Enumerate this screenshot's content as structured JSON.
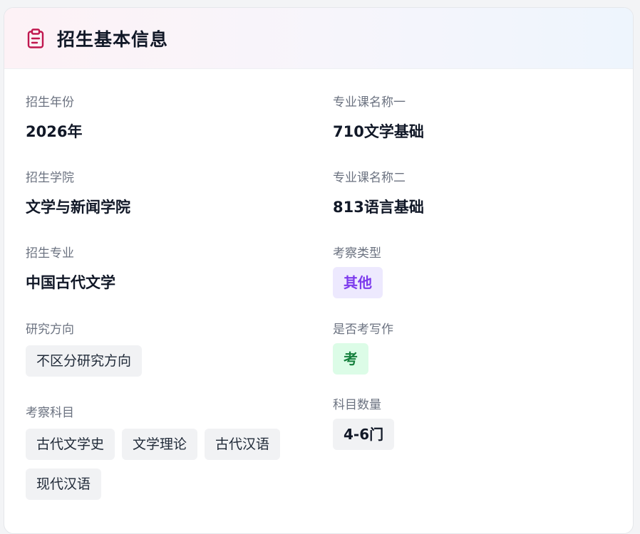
{
  "header": {
    "title": "招生基本信息",
    "icon": "clipboard-icon",
    "icon_color": "#c0174f"
  },
  "left": {
    "year": {
      "label": "招生年份",
      "value": "2026年"
    },
    "college": {
      "label": "招生学院",
      "value": "文学与新闻学院"
    },
    "major": {
      "label": "招生专业",
      "value": "中国古代文学"
    },
    "direction": {
      "label": "研究方向",
      "tag": "不区分研究方向"
    },
    "subjects": {
      "label": "考察科目",
      "tags": [
        "古代文学史",
        "文学理论",
        "古代汉语",
        "现代汉语"
      ]
    }
  },
  "right": {
    "course1": {
      "label": "专业课名称一",
      "value": "710文学基础"
    },
    "course2": {
      "label": "专业课名称二",
      "value": "813语言基础"
    },
    "exam_type": {
      "label": "考察类型",
      "tag": "其他",
      "color": "#7c3aed"
    },
    "writing": {
      "label": "是否考写作",
      "tag": "考",
      "color": "#15803d"
    },
    "count": {
      "label": "科目数量",
      "tag": "4-6门"
    }
  }
}
